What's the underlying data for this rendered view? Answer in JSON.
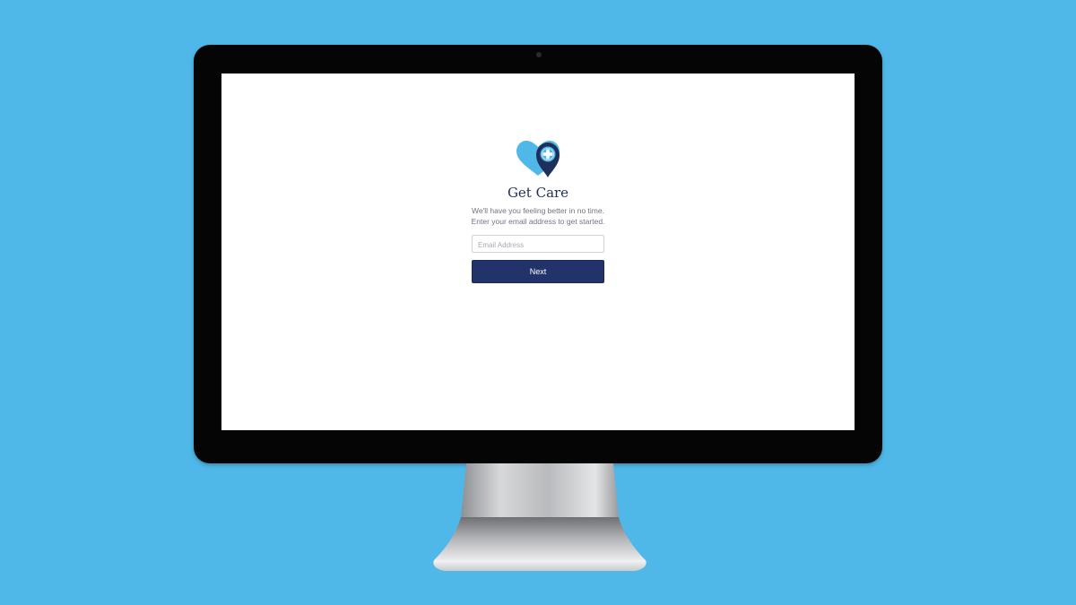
{
  "colors": {
    "background": "#4fb8e8",
    "accent": "#22336b",
    "logo_light": "#4fb8e8",
    "logo_dark": "#1e2f5c"
  },
  "login": {
    "logo_icon": "heart-location-pin-medical-cross-icon",
    "title": "Get Care",
    "subtitle_line1": "We'll have you feeling better in no time.",
    "subtitle_line2": "Enter your email address to get started.",
    "email_placeholder": "Email Address",
    "email_value": "",
    "next_label": "Next"
  }
}
